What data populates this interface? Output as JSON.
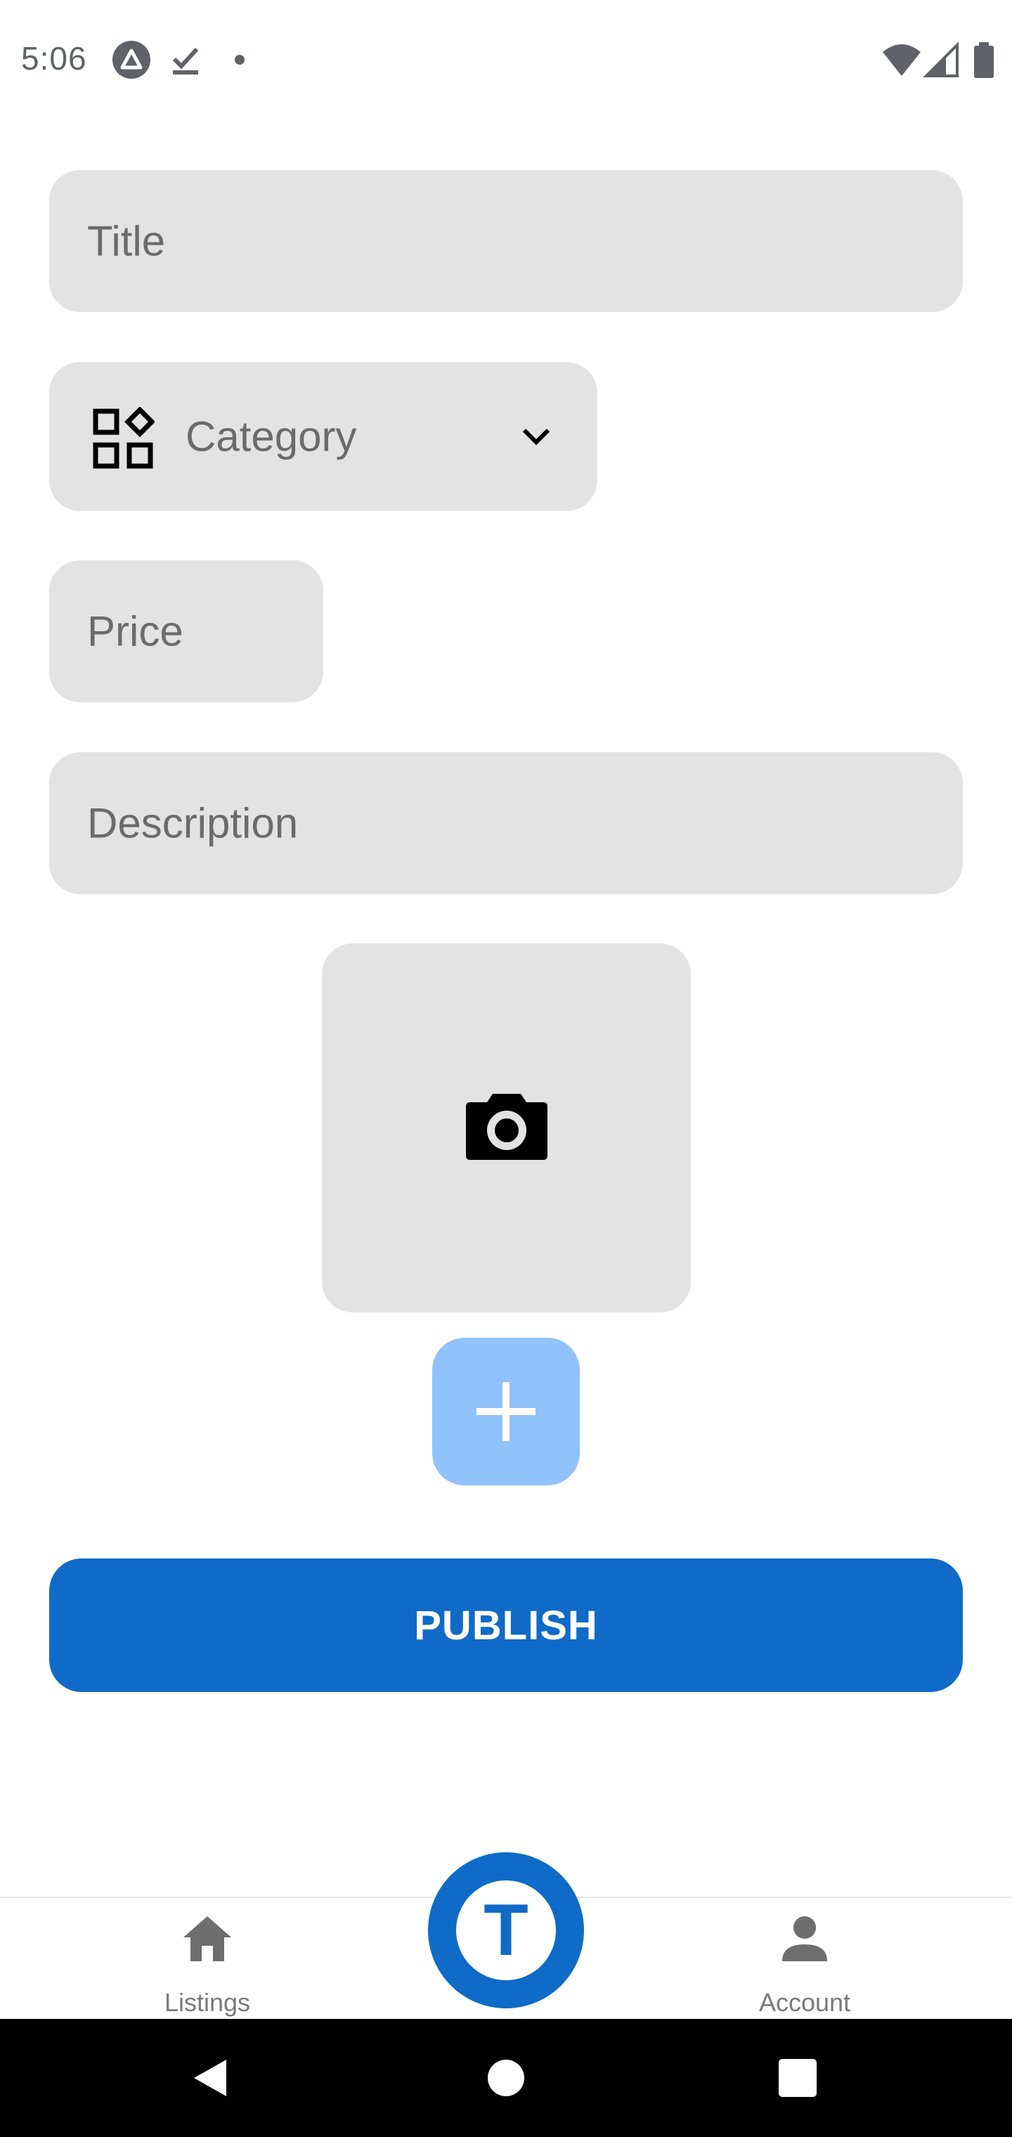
{
  "status_bar": {
    "time": "5:06",
    "left_icons": [
      "expo-badge-icon",
      "download-done-icon",
      "notification-dot-icon"
    ],
    "right_icons": [
      "wifi-icon",
      "cell-signal-icon",
      "battery-icon"
    ]
  },
  "form": {
    "title_placeholder": "Title",
    "category_placeholder": "Category",
    "price_placeholder": "Price",
    "description_placeholder": "Description"
  },
  "photo_slot": {
    "icon": "camera-icon"
  },
  "add_image": {
    "icon": "plus-icon"
  },
  "publish_label": "PUBLISH",
  "bottom_nav": {
    "listings_label": "Listings",
    "account_label": "Account",
    "center_letter": "T"
  },
  "colors": {
    "primary": "#0f6bc7",
    "add_button": "#90c2fb",
    "field_background": "#e3e3e3",
    "placeholder_text": "#6b6b6b"
  }
}
